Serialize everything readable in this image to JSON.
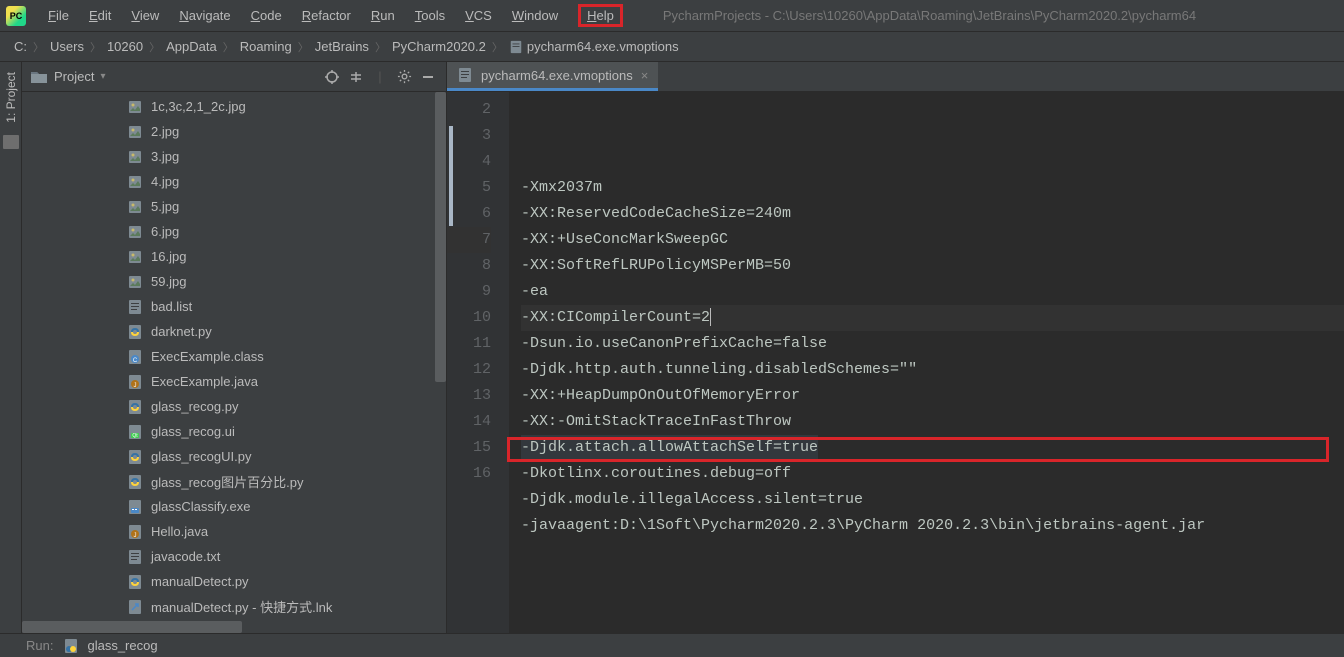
{
  "menu": {
    "items": [
      "File",
      "Edit",
      "View",
      "Navigate",
      "Code",
      "Refactor",
      "Run",
      "Tools",
      "VCS",
      "Window",
      "Help"
    ]
  },
  "windowTitle": "PycharmProjects - C:\\Users\\10260\\AppData\\Roaming\\JetBrains\\PyCharm2020.2\\pycharm64",
  "breadcrumbs": [
    "C:",
    "Users",
    "10260",
    "AppData",
    "Roaming",
    "JetBrains",
    "PyCharm2020.2",
    "pycharm64.exe.vmoptions"
  ],
  "projectPanel": {
    "title": "Project"
  },
  "sideTab": "1: Project",
  "tree": {
    "items": [
      {
        "icon": "img",
        "label": "1c,3c,2,1_2c.jpg"
      },
      {
        "icon": "img",
        "label": "2.jpg"
      },
      {
        "icon": "img",
        "label": "3.jpg"
      },
      {
        "icon": "img",
        "label": "4.jpg"
      },
      {
        "icon": "img",
        "label": "5.jpg"
      },
      {
        "icon": "img",
        "label": "6.jpg"
      },
      {
        "icon": "img",
        "label": "16.jpg"
      },
      {
        "icon": "img",
        "label": "59.jpg"
      },
      {
        "icon": "txt",
        "label": "bad.list"
      },
      {
        "icon": "py",
        "label": "darknet.py"
      },
      {
        "icon": "class",
        "label": "ExecExample.class"
      },
      {
        "icon": "java",
        "label": "ExecExample.java"
      },
      {
        "icon": "py",
        "label": "glass_recog.py"
      },
      {
        "icon": "ui",
        "label": "glass_recog.ui"
      },
      {
        "icon": "py",
        "label": "glass_recogUI.py"
      },
      {
        "icon": "py",
        "label": "glass_recog图片百分比.py"
      },
      {
        "icon": "exe",
        "label": "glassClassify.exe"
      },
      {
        "icon": "java",
        "label": "Hello.java"
      },
      {
        "icon": "txt",
        "label": "javacode.txt"
      },
      {
        "icon": "py",
        "label": "manualDetect.py"
      },
      {
        "icon": "lnk",
        "label": "manualDetect.py - 快捷方式.lnk"
      }
    ]
  },
  "editor": {
    "tab": "pycharm64.exe.vmoptions",
    "currentLine": 7,
    "lines": [
      {
        "n": 2,
        "text": "-Xmx2037m"
      },
      {
        "n": 3,
        "text": "-XX:ReservedCodeCacheSize=240m"
      },
      {
        "n": 4,
        "text": "-XX:+UseConcMarkSweepGC"
      },
      {
        "n": 5,
        "text": "-XX:SoftRefLRUPolicyMSPerMB=50"
      },
      {
        "n": 6,
        "text": "-ea"
      },
      {
        "n": 7,
        "text": "-XX:CICompilerCount=2"
      },
      {
        "n": 8,
        "text": "-Dsun.io.useCanonPrefixCache=false"
      },
      {
        "n": 9,
        "text": "-Djdk.http.auth.tunneling.disabledSchemes=\"\""
      },
      {
        "n": 10,
        "text": "-XX:+HeapDumpOnOutOfMemoryError"
      },
      {
        "n": 11,
        "text": "-XX:-OmitStackTraceInFastThrow"
      },
      {
        "n": 12,
        "text": "-Djdk.attach.allowAttachSelf=true"
      },
      {
        "n": 13,
        "text": "-Dkotlinx.coroutines.debug=off"
      },
      {
        "n": 14,
        "text": "-Djdk.module.illegalAccess.silent=true"
      },
      {
        "n": 15,
        "text": "-javaagent:D:\\1Soft\\Pycharm2020.2.3\\PyCharm 2020.2.3\\bin\\jetbrains-agent.jar"
      },
      {
        "n": 16,
        "text": ""
      }
    ]
  },
  "statusbar": {
    "label": "Run:",
    "file": "glass_recog"
  }
}
